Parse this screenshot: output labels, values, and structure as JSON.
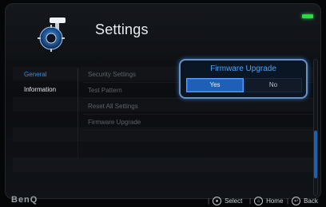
{
  "header": {
    "title": "Settings",
    "app_icon": "settings-gear-hammer-icon"
  },
  "left_menu": [
    {
      "label": "General",
      "active": true
    },
    {
      "label": "Information",
      "active": false
    }
  ],
  "right_menu": [
    {
      "label": "Security Settings"
    },
    {
      "label": "Test Pattern"
    },
    {
      "label": "Reset All Settings"
    },
    {
      "label": "Firmware Upgrade"
    }
  ],
  "dialog": {
    "title": "Firmware Upgrade",
    "yes_label": "Yes",
    "no_label": "No",
    "selected": "Yes"
  },
  "footer": {
    "brand": "BenQ",
    "hints": [
      {
        "icon": "select-circle-icon",
        "label": "Select"
      },
      {
        "icon": "home-circle-icon",
        "label": "Home"
      },
      {
        "icon": "back-circle-icon",
        "label": "Back"
      }
    ]
  },
  "colors": {
    "accent_blue": "#2f90e8",
    "dialog_border": "#6a8fc0",
    "battery_green": "#2fd84a"
  }
}
